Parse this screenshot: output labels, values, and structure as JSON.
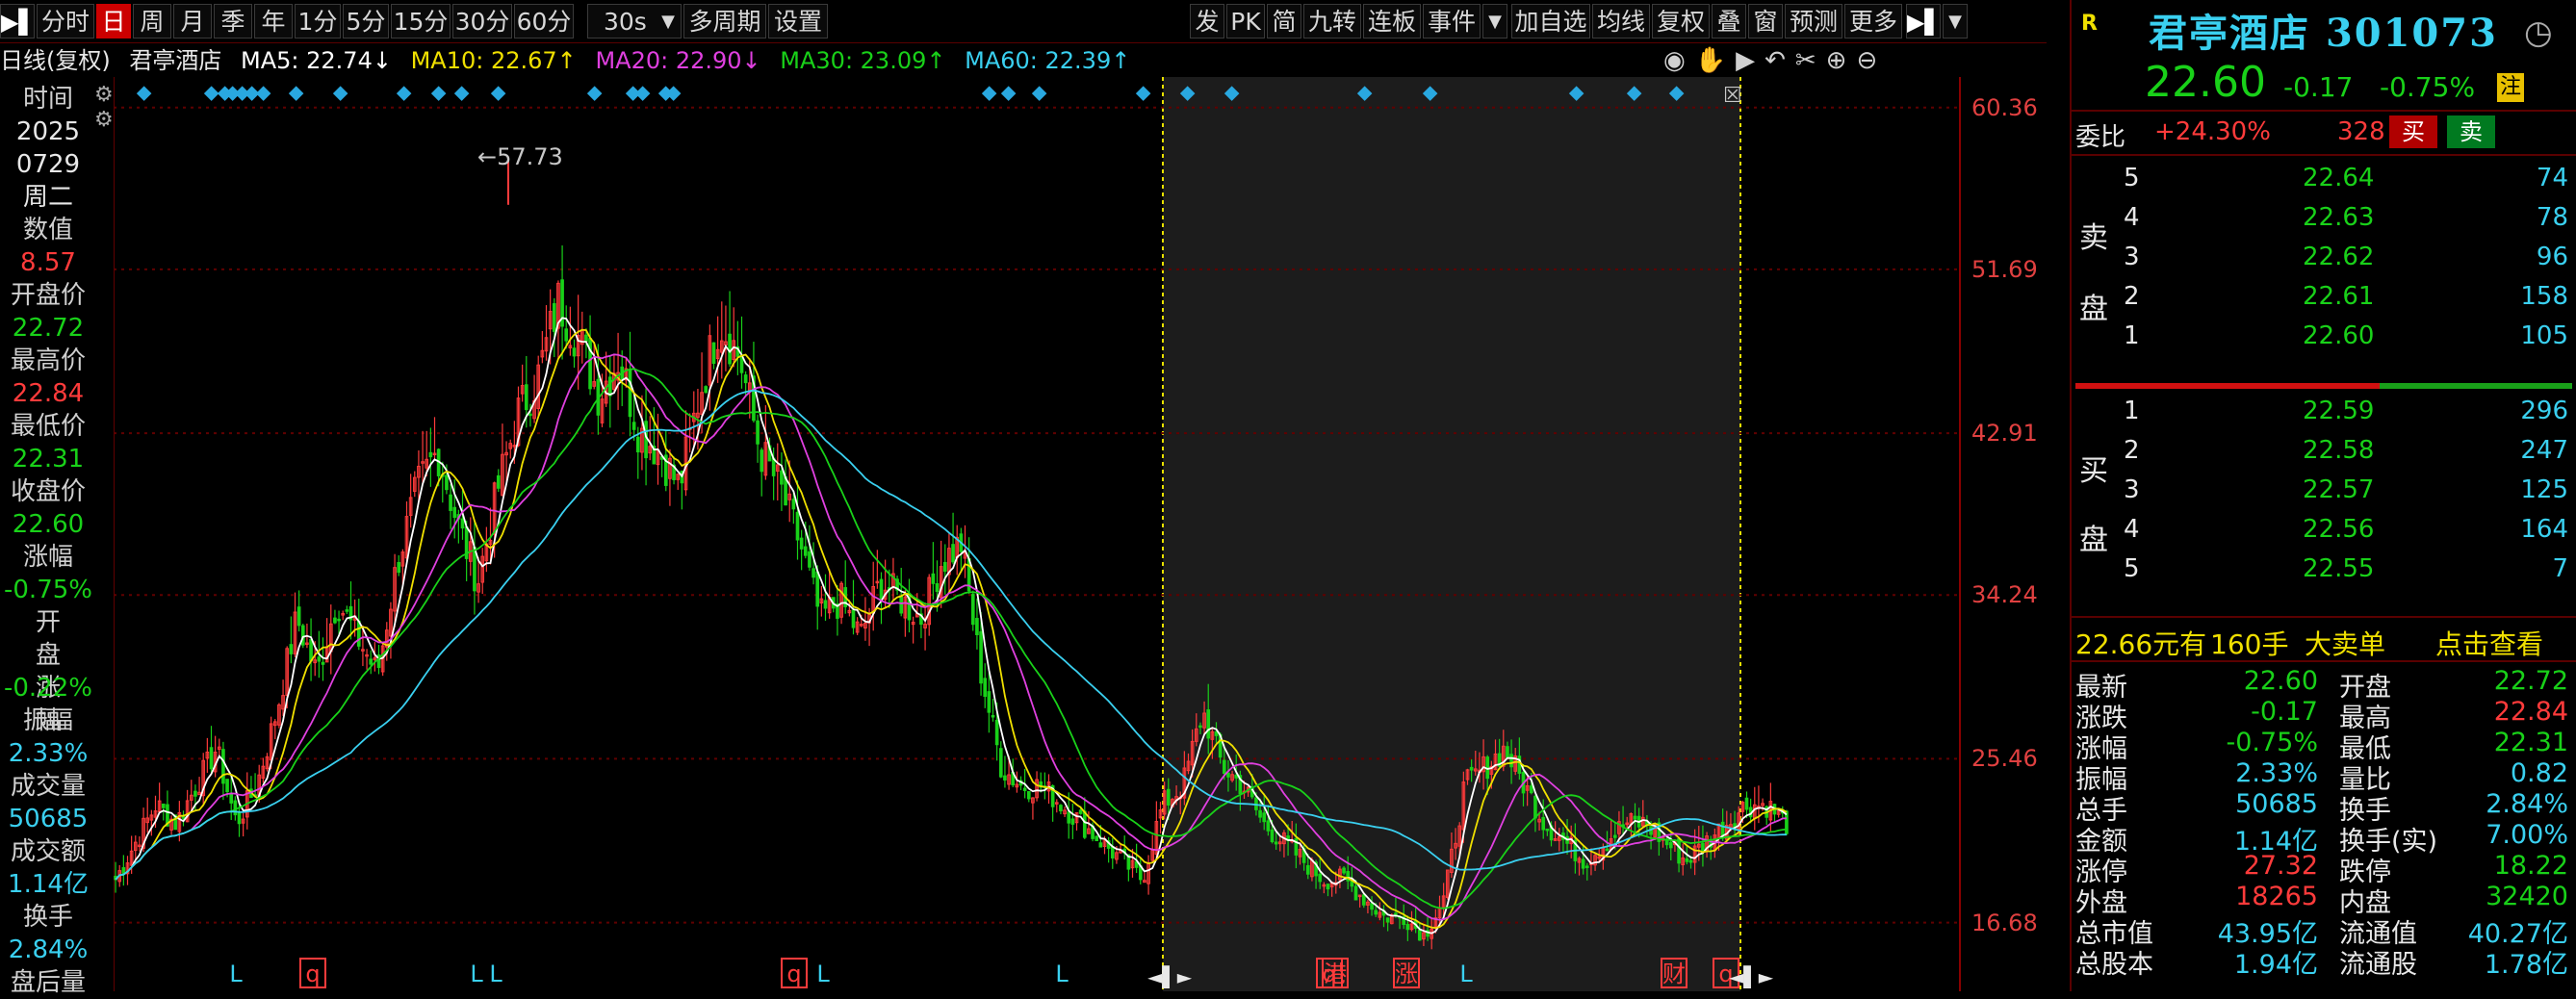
{
  "toolbar": {
    "left_items": [
      "分时",
      "日",
      "周",
      "月",
      "季",
      "年",
      "1分",
      "5分",
      "15分",
      "30分",
      "60分",
      "30s",
      "多周期",
      "设置"
    ],
    "right_items": [
      "发",
      "PK",
      "简",
      "九转",
      "连板",
      "事件",
      "加自选",
      "均线",
      "复权",
      "叠",
      "窗",
      "预测",
      "更多"
    ]
  },
  "infobar": {
    "period": "日线(复权)",
    "stock_name": "君亭酒店",
    "ma5": "MA5: 22.74↓",
    "ma10": "MA10: 22.67↑",
    "ma20": "MA20: 22.90↓",
    "ma30": "MA30: 23.09↑",
    "ma60": "MA60: 22.39↑"
  },
  "colors": {
    "ma5": "#ffffff",
    "ma10": "#f0e000",
    "ma20": "#e040e0",
    "ma30": "#19d119",
    "ma60": "#3ad0f0",
    "up": "#ff3b3b",
    "down": "#19d119"
  },
  "left_panel": [
    {
      "label": "时间",
      "value": "2025",
      "value2": "0729",
      "value3": "周二",
      "color": "white"
    },
    {
      "label": "数值",
      "value": "8.57",
      "color": "red"
    },
    {
      "label": "开盘价",
      "value": "22.72",
      "color": "green"
    },
    {
      "label": "最高价",
      "value": "22.84",
      "color": "red"
    },
    {
      "label": "最低价",
      "value": "22.31",
      "color": "green"
    },
    {
      "label": "收盘价",
      "value": "22.60",
      "color": "green"
    },
    {
      "label": "涨幅",
      "value": "-0.75%",
      "color": "green"
    },
    {
      "label": "开盘涨幅",
      "value": "-0.22%",
      "color": "green"
    },
    {
      "label": "振幅",
      "value": "2.33%",
      "color": "cyan"
    },
    {
      "label": "成交量",
      "value": "50685",
      "color": "cyan"
    },
    {
      "label": "成交额",
      "value": "1.14亿",
      "color": "cyan"
    },
    {
      "label": "换手",
      "value": "2.84%",
      "color": "cyan"
    },
    {
      "label": "盘后量",
      "value": "",
      "color": "white"
    }
  ],
  "yaxis": [
    "60.36",
    "51.69",
    "42.91",
    "34.24",
    "25.46",
    "16.68"
  ],
  "chart_data": {
    "type": "candlestick",
    "ylim": [
      13.0,
      62.0
    ],
    "yticks": [
      60.36,
      51.69,
      42.91,
      34.24,
      25.46,
      16.68
    ],
    "high_annotation": "57.73",
    "close_trend": [
      19,
      21,
      23,
      22,
      24,
      26,
      22,
      24,
      28,
      33,
      30,
      34,
      32,
      30,
      36,
      40,
      42,
      38,
      35,
      40,
      44,
      46,
      50,
      48,
      45,
      47,
      43,
      42,
      40,
      45,
      49,
      47,
      42,
      40,
      37,
      33,
      34,
      32,
      35,
      34,
      33,
      36,
      37,
      30,
      25,
      24,
      24,
      23,
      22,
      21,
      20,
      19,
      23,
      24,
      28,
      25,
      24,
      22,
      21,
      20,
      19,
      19,
      18,
      17,
      17,
      16,
      18,
      24,
      25,
      26,
      24,
      22,
      21,
      20,
      21,
      22,
      22,
      21,
      20,
      21,
      22,
      23,
      23,
      22
    ],
    "bottom_markers": [
      "L",
      "q",
      "L",
      "L",
      "q",
      "L",
      "L",
      "q",
      "港",
      "涨",
      "L",
      "财",
      "q"
    ]
  },
  "quote": {
    "flag": "R",
    "name": "君亭酒店",
    "code": "301073",
    "price": "22.60",
    "change": "-0.17",
    "pct": "-0.75%",
    "badge": "注",
    "weibi_label": "委比",
    "weibi": "+24.30%",
    "weicha": "328",
    "buy_btn": "买",
    "sell_btn": "卖",
    "sell_side_label": [
      "卖",
      "盘"
    ],
    "buy_side_label": [
      "买",
      "盘"
    ],
    "asks": [
      {
        "level": "5",
        "price": "22.64",
        "vol": "74"
      },
      {
        "level": "4",
        "price": "22.63",
        "vol": "78"
      },
      {
        "level": "3",
        "price": "22.62",
        "vol": "96"
      },
      {
        "level": "2",
        "price": "22.61",
        "vol": "158"
      },
      {
        "level": "1",
        "price": "22.60",
        "vol": "105"
      }
    ],
    "bids": [
      {
        "level": "1",
        "price": "22.59",
        "vol": "296"
      },
      {
        "level": "2",
        "price": "22.58",
        "vol": "247"
      },
      {
        "level": "3",
        "price": "22.57",
        "vol": "125"
      },
      {
        "level": "4",
        "price": "22.56",
        "vol": "164"
      },
      {
        "level": "5",
        "price": "22.55",
        "vol": "7"
      }
    ],
    "big_order": {
      "amount": "22.66元有",
      "hands": "160手",
      "type": "大卖单",
      "link": "点击查看"
    },
    "stats": [
      {
        "l1": "最新",
        "v1": "22.60",
        "c1": "green",
        "l2": "开盘",
        "v2": "22.72",
        "c2": "green"
      },
      {
        "l1": "涨跌",
        "v1": "-0.17",
        "c1": "green",
        "l2": "最高",
        "v2": "22.84",
        "c2": "red"
      },
      {
        "l1": "涨幅",
        "v1": "-0.75%",
        "c1": "green",
        "l2": "最低",
        "v2": "22.31",
        "c2": "green"
      },
      {
        "l1": "振幅",
        "v1": "2.33%",
        "c1": "cyan",
        "l2": "量比",
        "v2": "0.82",
        "c2": "cyan"
      },
      {
        "l1": "总手",
        "v1": "50685",
        "c1": "cyan",
        "l2": "换手",
        "v2": "2.84%",
        "c2": "cyan"
      },
      {
        "l1": "金额",
        "v1": "1.14亿",
        "c1": "cyan",
        "l2": "换手(实)",
        "v2": "7.00%",
        "c2": "cyan"
      },
      {
        "l1": "涨停",
        "v1": "27.32",
        "c1": "red",
        "l2": "跌停",
        "v2": "18.22",
        "c2": "green"
      },
      {
        "l1": "外盘",
        "v1": "18265",
        "c1": "red",
        "l2": "内盘",
        "v2": "32420",
        "c2": "green"
      },
      {
        "l1": "总市值",
        "v1": "43.95亿",
        "c1": "cyan",
        "l2": "流通值",
        "v2": "40.27亿",
        "c2": "cyan"
      },
      {
        "l1": "总股本",
        "v1": "1.94亿",
        "c1": "cyan",
        "l2": "流通股",
        "v2": "1.78亿",
        "c2": "cyan"
      }
    ]
  }
}
